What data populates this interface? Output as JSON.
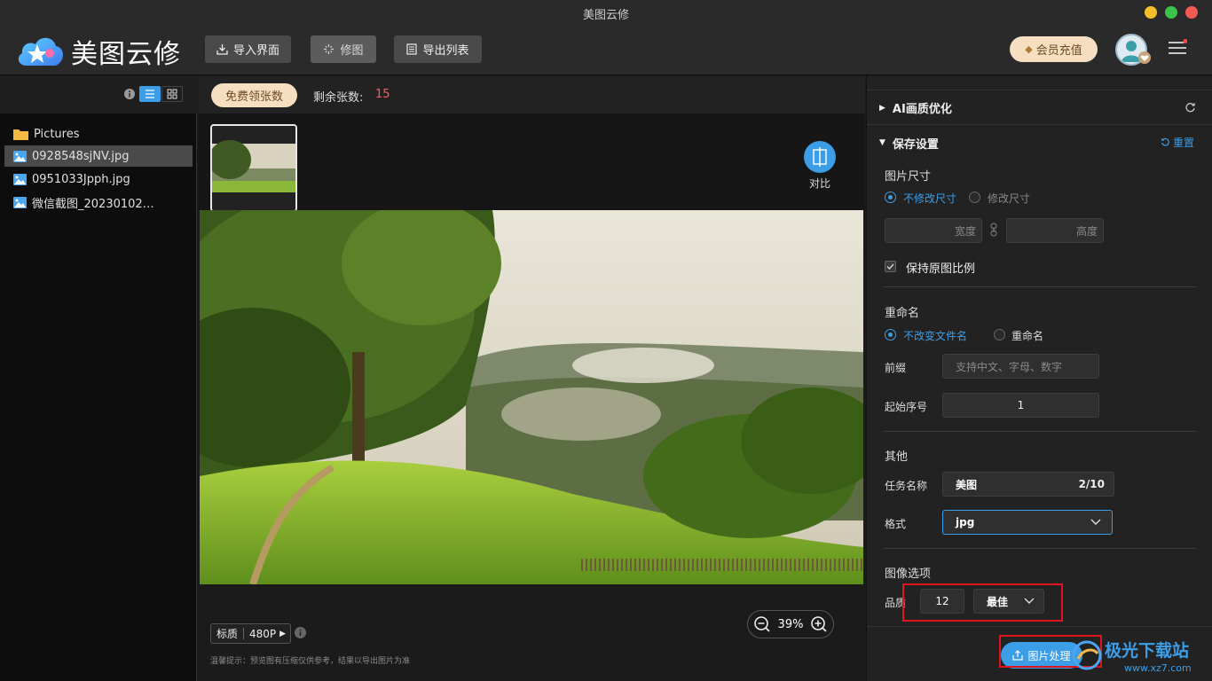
{
  "window": {
    "title": "美图云修"
  },
  "app": {
    "logo_text": "美图云修"
  },
  "toolbar": {
    "import_label": "导入界面",
    "retouch_label": "修图",
    "export_list_label": "导出列表",
    "vip_label": "会员充值"
  },
  "left_panel": {
    "folder": "Pictures",
    "files": [
      "0928548sjNV.jpg",
      "0951033Jpph.jpg",
      "微信截图_20230102…"
    ]
  },
  "center": {
    "free_btn": "免费领张数",
    "remain_label": "剩余张数:",
    "remain_value": "15",
    "compare_label": "对比",
    "quality_tag_label": "标质",
    "quality_tag_value": "480P",
    "zoom_value": "39%",
    "hint": "温馨提示：预览图有压缩仅供参考，结果以导出图片为准"
  },
  "right_panel": {
    "ai_section": "AI画质优化",
    "save_section": "保存设置",
    "reset_label": "重置",
    "size_title": "图片尺寸",
    "size_keep": "不修改尺寸",
    "size_change": "修改尺寸",
    "width_placeholder": "宽度",
    "height_placeholder": "高度",
    "keep_ratio": "保持原图比例",
    "rename_title": "重命名",
    "rename_keep": "不改变文件名",
    "rename_on": "重命名",
    "prefix_label": "前缀",
    "prefix_placeholder": "支持中文、字母、数字",
    "start_label": "起始序号",
    "start_value": "1",
    "other_title": "其他",
    "task_label": "任务名称",
    "task_value": "美图",
    "task_count": "2/10",
    "format_label": "格式",
    "format_value": "jpg",
    "image_options_title": "图像选项",
    "quality_label": "品质",
    "quality_value": "12",
    "quality_level": "最佳",
    "process_btn": "图片处理"
  },
  "watermark": {
    "text": "极光下载站",
    "url_text": "www.xz7.com"
  },
  "colors": {
    "accent": "#3d9ee8",
    "highlight_box": "#e0141e",
    "vip": "#f6dfc1"
  }
}
